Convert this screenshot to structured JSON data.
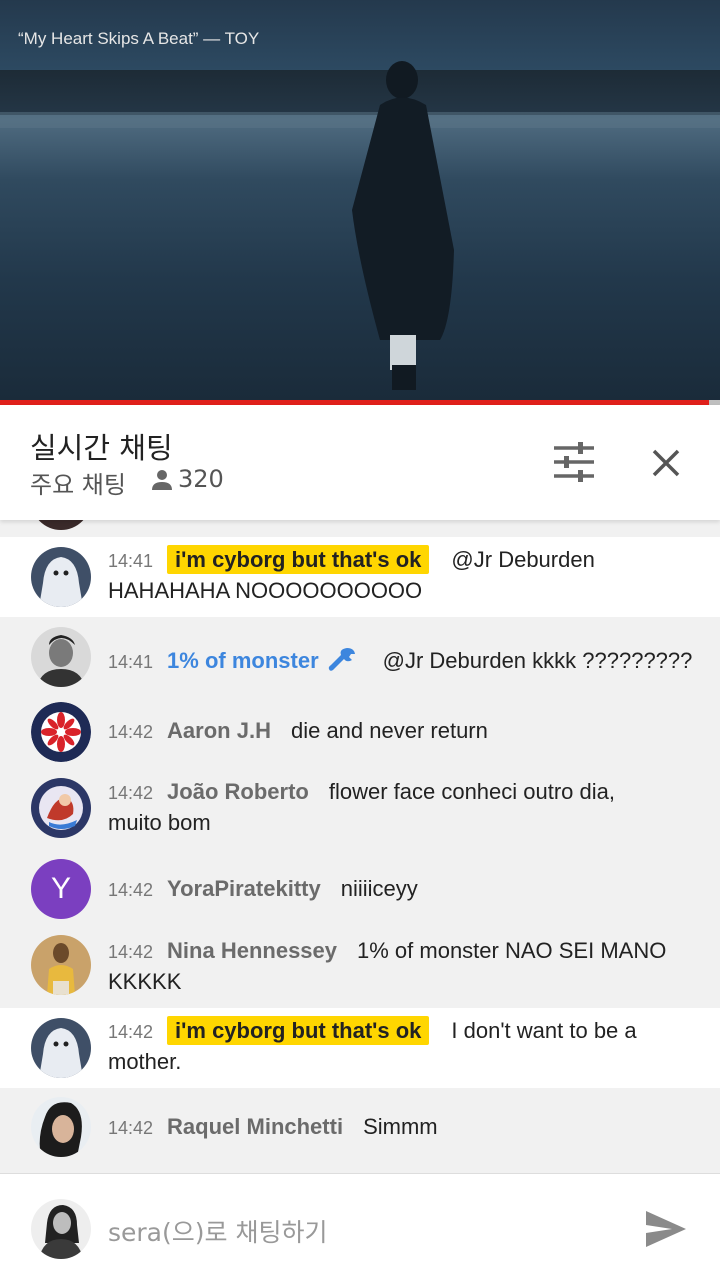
{
  "video": {
    "title": "“My Heart Skips A Beat” — TOY",
    "progress": 0.985
  },
  "header": {
    "title": "실시간 채팅",
    "mode": "주요 채팅",
    "viewer_count": "320"
  },
  "messages": [
    {
      "time": "14:41",
      "author": "i'm cyborg but that's ok",
      "text": "@Jr Deburden",
      "cont": "HAHAHAHA NOOOOOOOOOO"
    },
    {
      "time": "14:41",
      "author": "1% of monster",
      "text": "@Jr Deburden kkkk ?????????"
    },
    {
      "time": "14:42",
      "author": "Aaron J.H",
      "text": "die and never return"
    },
    {
      "time": "14:42",
      "author": "João Roberto",
      "text": "flower face conheci outro dia,",
      "cont": "muito bom"
    },
    {
      "time": "14:42",
      "author": "YoraPiratekitty",
      "text": "niiiiceyy",
      "avatar_letter": "Y"
    },
    {
      "time": "14:42",
      "author": "Nina Hennessey",
      "text": "1% of monster NAO SEI MANO",
      "cont": "KKKKK"
    },
    {
      "time": "14:42",
      "author": "i'm cyborg but that's ok",
      "text": "I don't want to be a",
      "cont": "mother."
    },
    {
      "time": "14:42",
      "author": "Raquel Minchetti",
      "text": "Simmm"
    }
  ],
  "composer": {
    "placeholder": "sera(으)로 채팅하기"
  },
  "colors": {
    "owner_highlight": "#ffd600",
    "moderator": "#3d86de",
    "progress": "#e0201b"
  },
  "icons": [
    "person-icon",
    "filter-icon",
    "close-icon",
    "wrench-icon",
    "send-icon"
  ]
}
